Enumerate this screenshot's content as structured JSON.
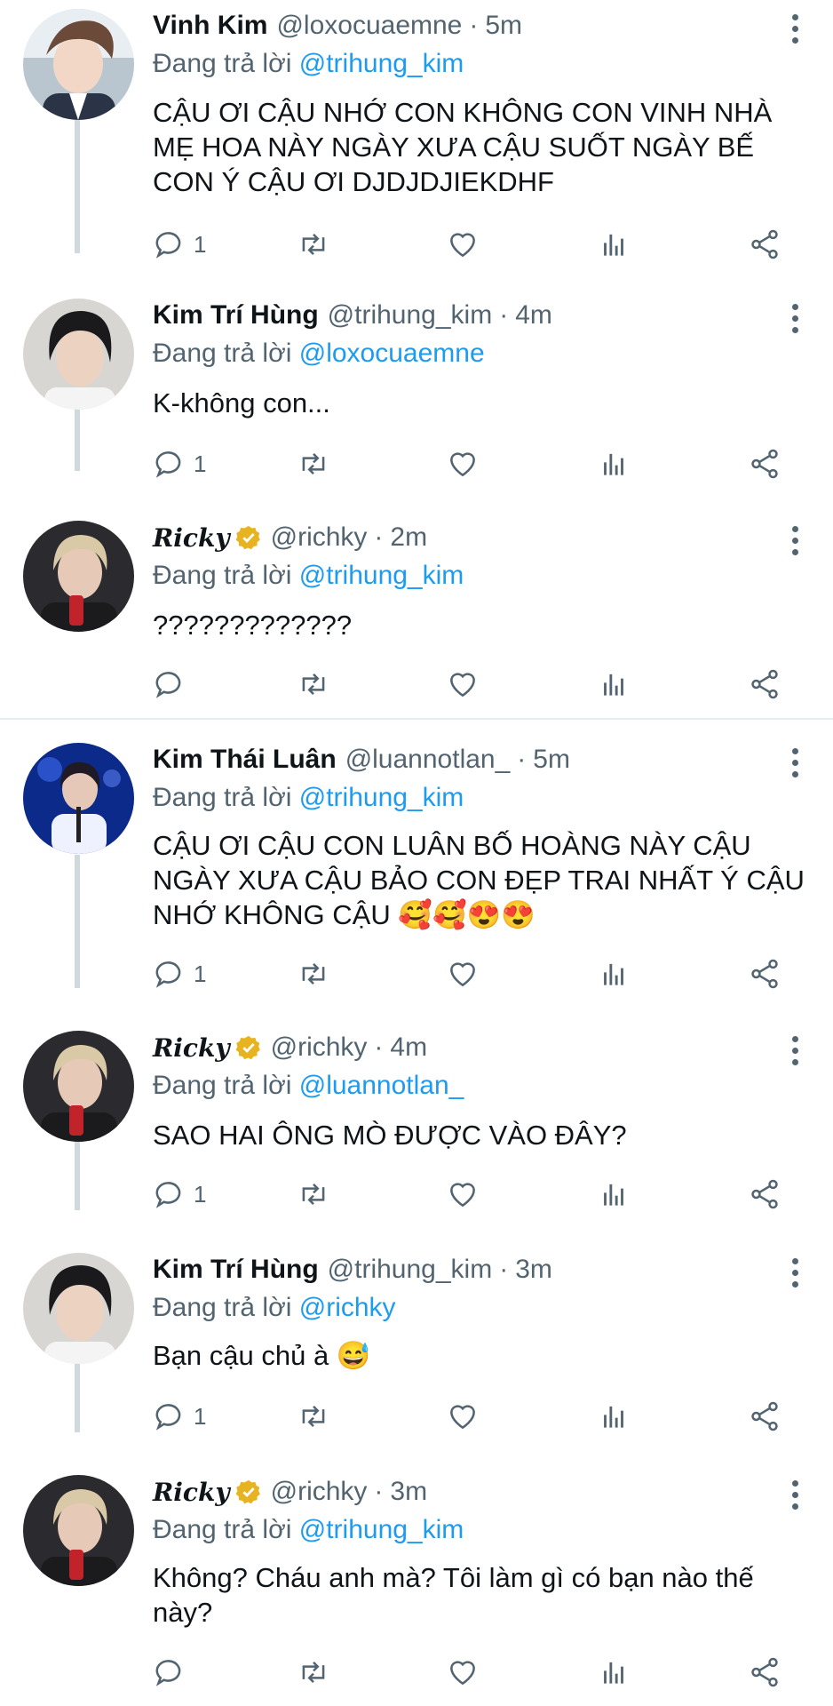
{
  "tweets": [
    {
      "name": "Vinh Kim",
      "handle": "@loxocuaemne",
      "time": "5m",
      "reply_prefix": "Đang trả lời",
      "reply_to": "@trihung_kim",
      "text": "CẬU ƠI CẬU NHỚ CON KHÔNG CON VINH NHÀ MẸ HOA NÀY NGÀY XƯA CẬU SUỐT NGÀY BẾ CON Ý CẬU ƠI DJDJDJIEKDHF",
      "reply_count": "1"
    },
    {
      "name": "Kim Trí Hùng",
      "handle": "@trihung_kim",
      "time": "4m",
      "reply_prefix": "Đang trả lời",
      "reply_to": "@loxocuaemne",
      "text": "K-không con...",
      "reply_count": "1"
    },
    {
      "name": "Ricky",
      "handle": "@richky",
      "time": "2m",
      "reply_prefix": "Đang trả lời",
      "reply_to": "@trihung_kim",
      "text": "?????????????",
      "reply_count": ""
    },
    {
      "name": "Kim Thái Luân",
      "handle": "@luannotlan_",
      "time": "5m",
      "reply_prefix": "Đang trả lời",
      "reply_to": "@trihung_kim",
      "text": "CẬU ƠI CẬU CON LUÂN BỐ HOÀNG NÀY CẬU NGÀY XƯA CẬU BẢO CON ĐẸP TRAI NHẤT Ý CẬU NHỚ KHÔNG CẬU",
      "emoji": "🥰🥰😍😍",
      "reply_count": "1"
    },
    {
      "name": "Ricky",
      "handle": "@richky",
      "time": "4m",
      "reply_prefix": "Đang trả lời",
      "reply_to": "@luannotlan_",
      "text": "SAO HAI ÔNG MÒ ĐƯỢC VÀO ĐÂY?",
      "reply_count": "1"
    },
    {
      "name": "Kim Trí Hùng",
      "handle": "@trihung_kim",
      "time": "3m",
      "reply_prefix": "Đang trả lời",
      "reply_to": "@richky",
      "text": "Bạn cậu chủ à",
      "emoji": "😅",
      "reply_count": "1"
    },
    {
      "name": "Ricky",
      "handle": "@richky",
      "time": "3m",
      "reply_prefix": "Đang trả lời",
      "reply_to": "@trihung_kim",
      "text": "Không? Cháu anh mà? Tôi làm gì có bạn nào thế này?",
      "reply_count": ""
    }
  ],
  "dot": "·",
  "colors": {
    "accent": "#1d9bf0",
    "muted": "#536471",
    "verified": "#e8b321"
  },
  "icons": {
    "reply": "reply-icon",
    "retweet": "retweet-icon",
    "like": "heart-icon",
    "views": "analytics-icon",
    "share": "share-icon",
    "more": "more-vertical-icon"
  }
}
